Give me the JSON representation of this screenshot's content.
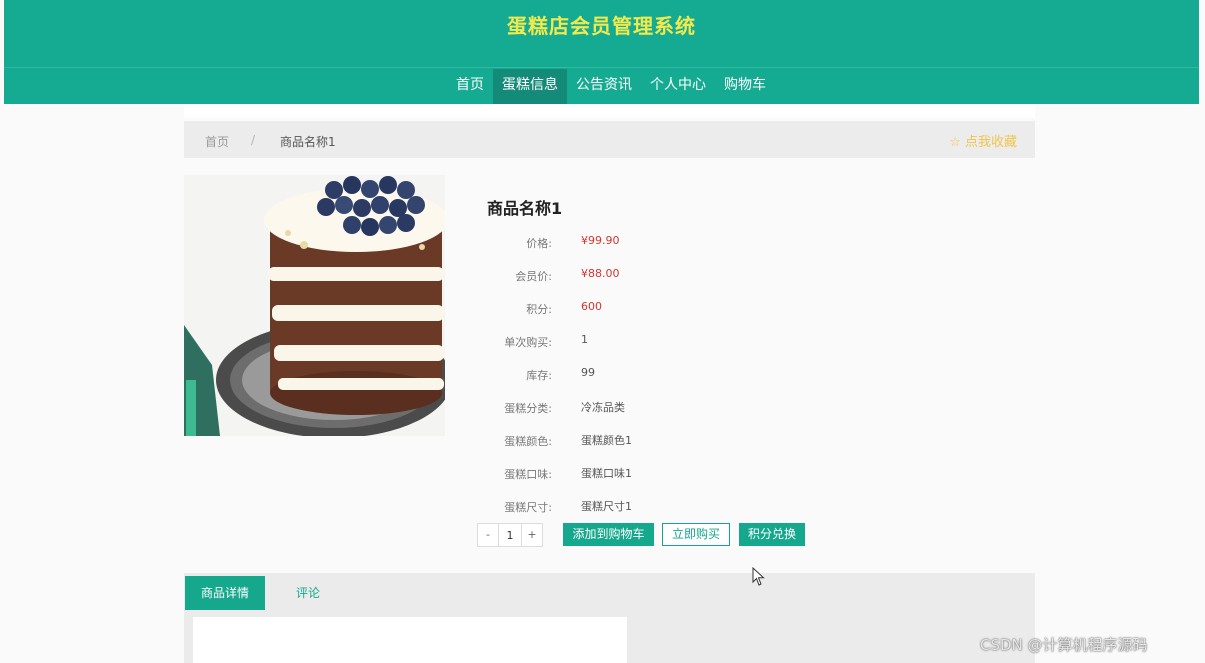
{
  "site": {
    "title": "蛋糕店会员管理系统"
  },
  "nav": {
    "items": [
      {
        "label": "首页",
        "active": false
      },
      {
        "label": "蛋糕信息",
        "active": true
      },
      {
        "label": "公告资讯",
        "active": false
      },
      {
        "label": "个人中心",
        "active": false
      },
      {
        "label": "购物车",
        "active": false
      }
    ]
  },
  "breadcrumb": {
    "home": "首页",
    "separator": "/",
    "current": "商品名称1",
    "favorite_label": "☆ 点我收藏"
  },
  "product": {
    "name": "商品名称1",
    "specs": [
      {
        "label": "价格:",
        "value": "¥99.90",
        "highlight": true
      },
      {
        "label": "会员价:",
        "value": "¥88.00",
        "highlight": true
      },
      {
        "label": "积分:",
        "value": "600",
        "highlight": true
      },
      {
        "label": "单次购买:",
        "value": "1",
        "highlight": false
      },
      {
        "label": "库存:",
        "value": "99",
        "highlight": false
      },
      {
        "label": "蛋糕分类:",
        "value": "冷冻品类",
        "highlight": false
      },
      {
        "label": "蛋糕颜色:",
        "value": "蛋糕颜色1",
        "highlight": false
      },
      {
        "label": "蛋糕口味:",
        "value": "蛋糕口味1",
        "highlight": false
      },
      {
        "label": "蛋糕尺寸:",
        "value": "蛋糕尺寸1",
        "highlight": false
      }
    ]
  },
  "purchase": {
    "minus": "-",
    "quantity": "1",
    "plus": "+",
    "add_to_cart": "添加到购物车",
    "buy_now": "立即购买",
    "points_exchange": "积分兑换"
  },
  "tabs": {
    "detail": "商品详情",
    "comment": "评论"
  },
  "watermark": "CSDN @计算机程序源码",
  "colors": {
    "primary": "#15ab92",
    "title": "#f2e94c",
    "price": "#d4362f",
    "favorite": "#f0c54b"
  }
}
